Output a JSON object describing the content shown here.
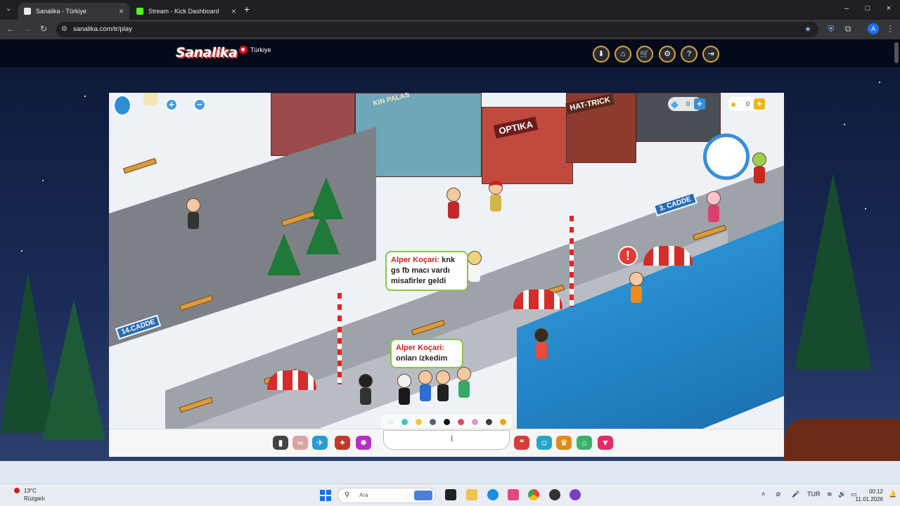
{
  "browser": {
    "tabs": [
      {
        "title": "Sanalika - Türkiye",
        "active": true
      },
      {
        "title": "Stream - Kick Dashboard",
        "active": false
      }
    ],
    "new_tab": "+",
    "url": "sanalika.com/tr/play",
    "profile_initial": "A"
  },
  "site": {
    "logo": "Sanalika",
    "region": "Türkiye",
    "header_icons": [
      "download-icon",
      "home-icon",
      "cart-icon",
      "gear-icon",
      "help-icon",
      "logout-icon"
    ],
    "header_glyphs": [
      "⬇",
      "⌂",
      "🛒",
      "⚙",
      "?",
      "⇥"
    ]
  },
  "game": {
    "diamond_count": "0",
    "coin_count": "0",
    "street_signs": [
      "3. CADDE",
      "14.CADDE"
    ],
    "shop_signs": [
      "OPTIKA",
      "HAT-TRICK",
      "KIN PALAS"
    ],
    "bubbles": [
      {
        "user": "Alper Koçari:",
        "text": "knk gs fb macı vardı misafirler geldi"
      },
      {
        "user": "Alper Koçari:",
        "text": "onları izkedim"
      }
    ],
    "alert_mark": "!",
    "colors": [
      "#e6f2ee",
      "#3cc7b8",
      "#f2c530",
      "#596070",
      "#111111",
      "#d64d5a",
      "#e88fd8",
      "#3c3c3c",
      "#f2a10f"
    ]
  },
  "taskbar": {
    "weather_temp": "13°C",
    "weather_desc": "Rüzgarlı",
    "search_placeholder": "Ara",
    "lang": "TUR",
    "time": "00:12",
    "date": "11.01.2026"
  }
}
